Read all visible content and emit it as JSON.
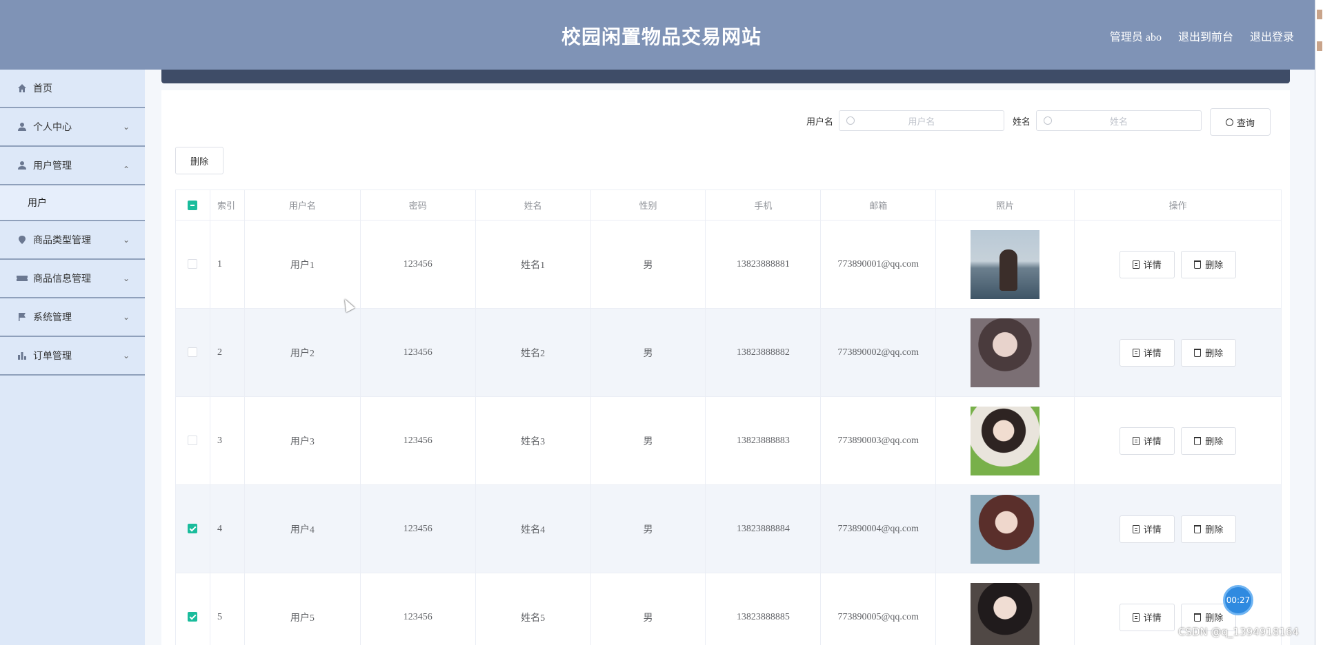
{
  "header": {
    "title": "校园闲置物品交易网站",
    "admin_label": "管理员 abo",
    "to_front_label": "退出到前台",
    "logout_label": "退出登录"
  },
  "sidebar": {
    "items": [
      {
        "label": "首页",
        "icon": "home-icon"
      },
      {
        "label": "个人中心",
        "icon": "user-icon"
      },
      {
        "label": "用户管理",
        "icon": "user-icon"
      },
      {
        "label": "商品类型管理",
        "icon": "location-icon"
      },
      {
        "label": "商品信息管理",
        "icon": "ticket-icon"
      },
      {
        "label": "系统管理",
        "icon": "flag-icon"
      },
      {
        "label": "订单管理",
        "icon": "bar-chart-icon"
      }
    ],
    "sub_item": "用户"
  },
  "search": {
    "username_label": "用户名",
    "username_placeholder": "用户名",
    "name_label": "姓名",
    "name_placeholder": "姓名",
    "query_button": "查询"
  },
  "toolbar": {
    "delete_label": "删除"
  },
  "table": {
    "columns": [
      "索引",
      "用户名",
      "密码",
      "姓名",
      "性别",
      "手机",
      "邮箱",
      "照片",
      "操作"
    ],
    "rows": [
      {
        "index": "1",
        "username": "用户1",
        "password": "123456",
        "name": "姓名1",
        "gender": "男",
        "phone": "13823888881",
        "email": "773890001@qq.com",
        "checked": false
      },
      {
        "index": "2",
        "username": "用户2",
        "password": "123456",
        "name": "姓名2",
        "gender": "男",
        "phone": "13823888882",
        "email": "773890002@qq.com",
        "checked": false
      },
      {
        "index": "3",
        "username": "用户3",
        "password": "123456",
        "name": "姓名3",
        "gender": "男",
        "phone": "13823888883",
        "email": "773890003@qq.com",
        "checked": false
      },
      {
        "index": "4",
        "username": "用户4",
        "password": "123456",
        "name": "姓名4",
        "gender": "男",
        "phone": "13823888884",
        "email": "773890004@qq.com",
        "checked": true
      },
      {
        "index": "5",
        "username": "用户5",
        "password": "123456",
        "name": "姓名5",
        "gender": "男",
        "phone": "13823888885",
        "email": "773890005@qq.com",
        "checked": true
      }
    ],
    "detail_label": "详情",
    "delete_label": "删除"
  },
  "overlay": {
    "timer": "00:27",
    "watermark": "CSDN @q_1394918164"
  },
  "colors": {
    "header_bg": "#7f93b6",
    "sidebar_bg": "#dde8f8",
    "accent": "#1abc9c"
  }
}
